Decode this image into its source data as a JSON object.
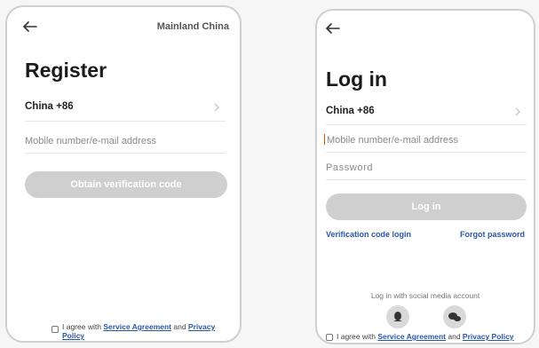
{
  "register": {
    "region_link": "Mainland China",
    "title": "Register",
    "country_label": "China +86",
    "account_placeholder": "Mobile number/e-mail address",
    "submit_label": "Obtain verification code",
    "agreement": {
      "prefix": "I agree with ",
      "service_link": "Service Agreement",
      "middle": " and ",
      "privacy_link": "Privacy Policy"
    }
  },
  "login": {
    "title": "Log in",
    "country_label": "China +86",
    "account_placeholder": "Mobile number/e-mail address",
    "password_placeholder": "Password",
    "submit_label": "Log in",
    "verification_link": "Verification code login",
    "forgot_link": "Forgot password",
    "social_caption": "Log in with social media account",
    "social_buttons": [
      "qq-icon",
      "wechat-icon"
    ],
    "agreement": {
      "prefix": "I agree with ",
      "service_link": "Service Agreement",
      "middle": " and ",
      "privacy_link": "Privacy Policy"
    }
  },
  "colors": {
    "button_disabled": "#cfcfcf",
    "link": "#2a58a8",
    "cursor": "#d35400"
  }
}
